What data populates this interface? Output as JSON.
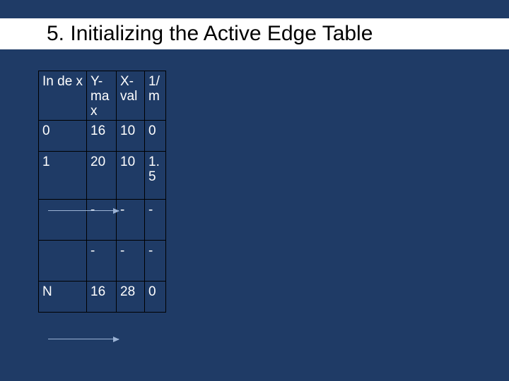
{
  "title": "5. Initializing the Active Edge Table",
  "table": {
    "headers": {
      "index": "In\nde\nx",
      "ymax": "Y-\nma\nx",
      "xval": "X-\nval",
      "m": "1/\nm"
    },
    "rows": [
      {
        "index": "0",
        "ymax": "16",
        "xval": "10",
        "m": "0"
      },
      {
        "index": "1",
        "ymax": "20",
        "xval": "10",
        "m": "1.\n5"
      },
      {
        "index": "",
        "ymax": "-",
        "xval": "-",
        "m": "-"
      },
      {
        "index": "",
        "ymax": "-",
        "xval": "-",
        "m": "-"
      },
      {
        "index": "N",
        "ymax": "16",
        "xval": "28",
        "m": "0"
      }
    ]
  }
}
